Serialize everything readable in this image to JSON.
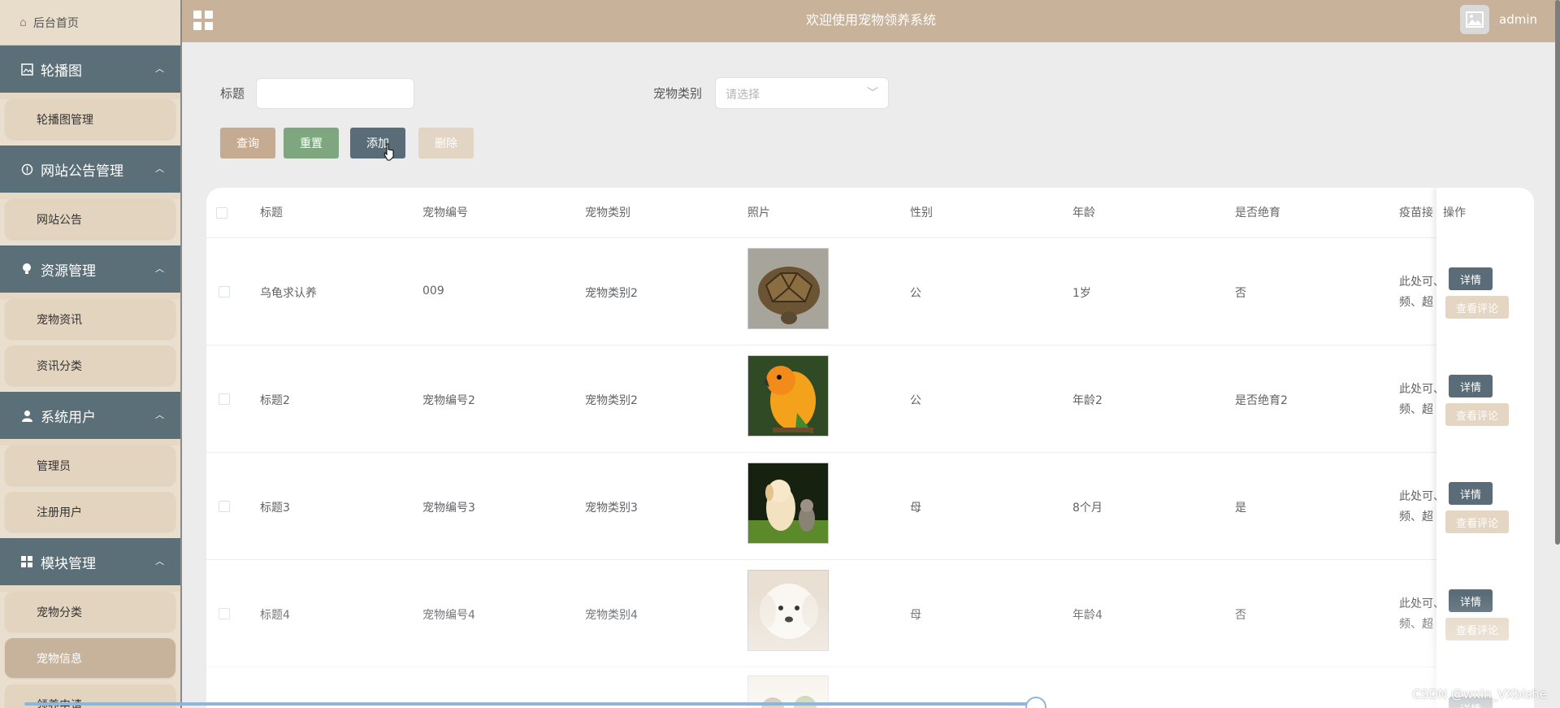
{
  "sidebar": {
    "home_label": "后台首页",
    "groups": [
      {
        "title": "轮播图",
        "items": [
          "轮播图管理"
        ]
      },
      {
        "title": "网站公告管理",
        "items": [
          "网站公告"
        ]
      },
      {
        "title": "资源管理",
        "items": [
          "宠物资讯",
          "资讯分类"
        ]
      },
      {
        "title": "系统用户",
        "items": [
          "管理员",
          "注册用户"
        ]
      },
      {
        "title": "模块管理",
        "items": [
          "宠物分类",
          "宠物信息",
          "领养申请"
        ]
      }
    ],
    "active_item": "宠物信息"
  },
  "header": {
    "title": "欢迎使用宠物领养系统",
    "user": "admin"
  },
  "filter": {
    "title_label": "标题",
    "title_value": "",
    "category_label": "宠物类别",
    "category_placeholder": "请选择",
    "buttons": {
      "query": "查询",
      "reset": "重置",
      "add": "添加",
      "delete": "删除"
    }
  },
  "table": {
    "columns": [
      "标题",
      "宠物编号",
      "宠物类别",
      "照片",
      "性别",
      "年龄",
      "是否绝育",
      "疫苗接",
      "操作"
    ],
    "rows": [
      {
        "title": "乌龟求认养",
        "code": "009",
        "category": "宠物类别2",
        "photo": "tortoise",
        "gender": "公",
        "age": "1岁",
        "neutered": "否",
        "vaccine_line1": "此处可、",
        "vaccine_line2": "频、超"
      },
      {
        "title": "标题2",
        "code": "宠物编号2",
        "category": "宠物类别2",
        "photo": "parrot",
        "gender": "公",
        "age": "年龄2",
        "neutered": "是否绝育2",
        "vaccine_line1": "此处可、",
        "vaccine_line2": "频、超"
      },
      {
        "title": "标题3",
        "code": "宠物编号3",
        "category": "宠物类别3",
        "photo": "puppy-kitten",
        "gender": "母",
        "age": "8个月",
        "neutered": "是",
        "vaccine_line1": "此处可、",
        "vaccine_line2": "频、超"
      },
      {
        "title": "标题4",
        "code": "宠物编号4",
        "category": "宠物类别4",
        "photo": "white-dog",
        "gender": "母",
        "age": "年龄4",
        "neutered": "否",
        "vaccine_line1": "此处可、",
        "vaccine_line2": "频、超"
      }
    ],
    "actions": {
      "detail": "详情",
      "review": "查看评论"
    }
  },
  "watermark": "CSDN @wxin_VXbishe",
  "colors": {
    "header": "#c8b29a",
    "group_head": "#5b6f79",
    "btn_query": "#c4ab91",
    "btn_reset": "#7ea77f",
    "btn_add": "#5a6c77",
    "btn_delete": "#e2d5c3"
  }
}
